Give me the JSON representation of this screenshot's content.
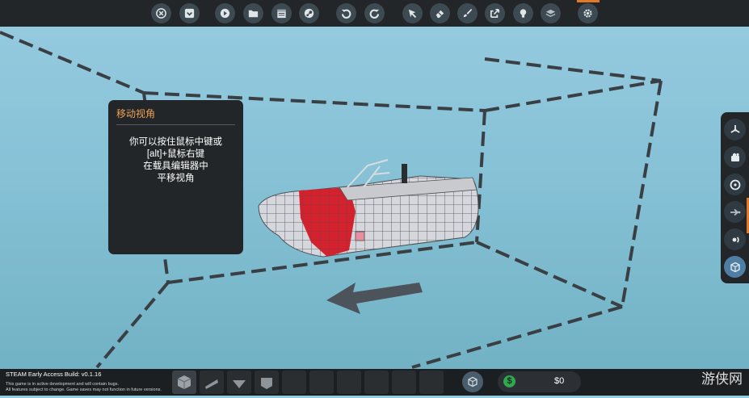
{
  "toolbar": {
    "buttons": [
      {
        "name": "close-icon"
      },
      {
        "name": "inbox-icon"
      },
      {
        "name": "play-icon"
      },
      {
        "name": "folder-icon"
      },
      {
        "name": "calendar-icon"
      },
      {
        "name": "steam-icon"
      },
      {
        "name": "undo-icon"
      },
      {
        "name": "redo-icon"
      },
      {
        "name": "cursor-icon"
      },
      {
        "name": "eraser-icon"
      },
      {
        "name": "paint-icon"
      },
      {
        "name": "transform-icon"
      },
      {
        "name": "bulb-icon"
      },
      {
        "name": "layers-icon"
      },
      {
        "name": "gear-icon"
      }
    ]
  },
  "tooltip": {
    "title": "移动视角",
    "lines": [
      "你可以按住鼠标中键或",
      "[alt]+鼠标右键",
      "在载具编辑器中",
      "平移视角"
    ]
  },
  "right_panel": {
    "buttons": [
      {
        "name": "fan-icon"
      },
      {
        "name": "camera-icon"
      },
      {
        "name": "target-icon"
      },
      {
        "name": "arrow-icon"
      },
      {
        "name": "sound-icon"
      },
      {
        "name": "cube-icon",
        "active": true
      }
    ]
  },
  "footer": {
    "build": "STEAM Early Access Build: v0.1.16",
    "note_line1": "This game is in active development and will contain bugs.",
    "note_line2": "All features subject to change. Game saves may not function in future versions."
  },
  "money": {
    "value": "$0",
    "symbol": "$"
  },
  "watermark": "游侠网",
  "colors": {
    "topbar": "#232628",
    "accent": "#e07a2a",
    "tooltip_title": "#f0a257",
    "hull_red": "#d3222d",
    "money_green": "#2fa84f"
  }
}
